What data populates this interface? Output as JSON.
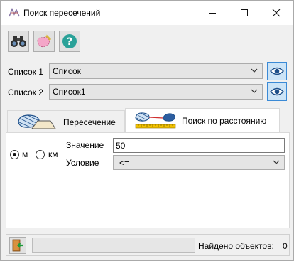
{
  "window": {
    "title": "Поиск пересечений",
    "icon": "intersection-app-icon",
    "controls": [
      "minimize-icon",
      "maximize-icon",
      "close-icon"
    ]
  },
  "toolbar": {
    "buttons": [
      {
        "icon": "binoculars-icon"
      },
      {
        "icon": "select-area-icon"
      },
      {
        "icon": "help-icon"
      }
    ]
  },
  "list1": {
    "label": "Список 1",
    "value": "Список"
  },
  "list2": {
    "label": "Список 2",
    "value": "Список1"
  },
  "tabs": [
    {
      "label": "Пересечение",
      "selected": false
    },
    {
      "label": "Поиск по расстоянию",
      "selected": true
    }
  ],
  "distance_panel": {
    "units": [
      {
        "label": "м",
        "checked": true
      },
      {
        "label": "км",
        "checked": false
      }
    ],
    "value_label": "Значение",
    "value": "50",
    "condition_label": "Условие",
    "condition": "<="
  },
  "status": {
    "found_label": "Найдено объектов:",
    "found_count": "0",
    "progress": 0
  },
  "colors": {
    "accent": "#3b8ad6",
    "help": "#2aa198"
  }
}
